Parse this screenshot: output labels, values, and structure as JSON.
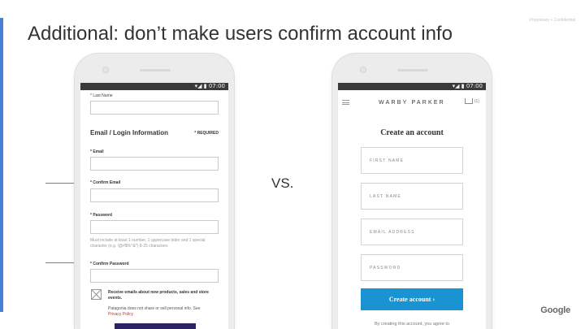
{
  "slide": {
    "title": "Additional: don’t make users confirm account info",
    "proprietary": "Proprietary + Confidential",
    "vs_label": "VS.",
    "logo": "Google",
    "accent_color": "#4a7fd6",
    "arrow_color": "#c253b4"
  },
  "left_phone": {
    "status_time": "▾◢ ▮ 07:00",
    "last_name_label": "* Last Name",
    "section_title": "Email / Login Information",
    "required_label": "* REQUIRED",
    "email_label": "* Email",
    "confirm_email_label": "* Confirm Email",
    "password_label": "* Password",
    "password_help": "Must include at least 1 number, 1 uppercase letter and 1 special character (e.g. !@#$%^&*) 8-25 characters",
    "confirm_password_label": "* Confirm Password",
    "promo_text": "Receive emails about new products, sales and store events.",
    "privacy_text": "Patagonia does not share or sell personal info. See",
    "privacy_link": "Privacy Policy",
    "checkbox_state": "checked",
    "submit_color": "#2b2565"
  },
  "right_phone": {
    "status_time": "▾◢ ▮ 07:00",
    "brand": "WARBY PARKER",
    "cart_count": "(1)",
    "heading": "Create an account",
    "first_name_placeholder": "FIRST NAME",
    "last_name_placeholder": "LAST NAME",
    "email_placeholder": "EMAIL ADDRESS",
    "password_placeholder": "PASSWORD",
    "create_button": "Create account ›",
    "fine_print": "By creating this account, you agree to",
    "button_color": "#1a93d2"
  }
}
